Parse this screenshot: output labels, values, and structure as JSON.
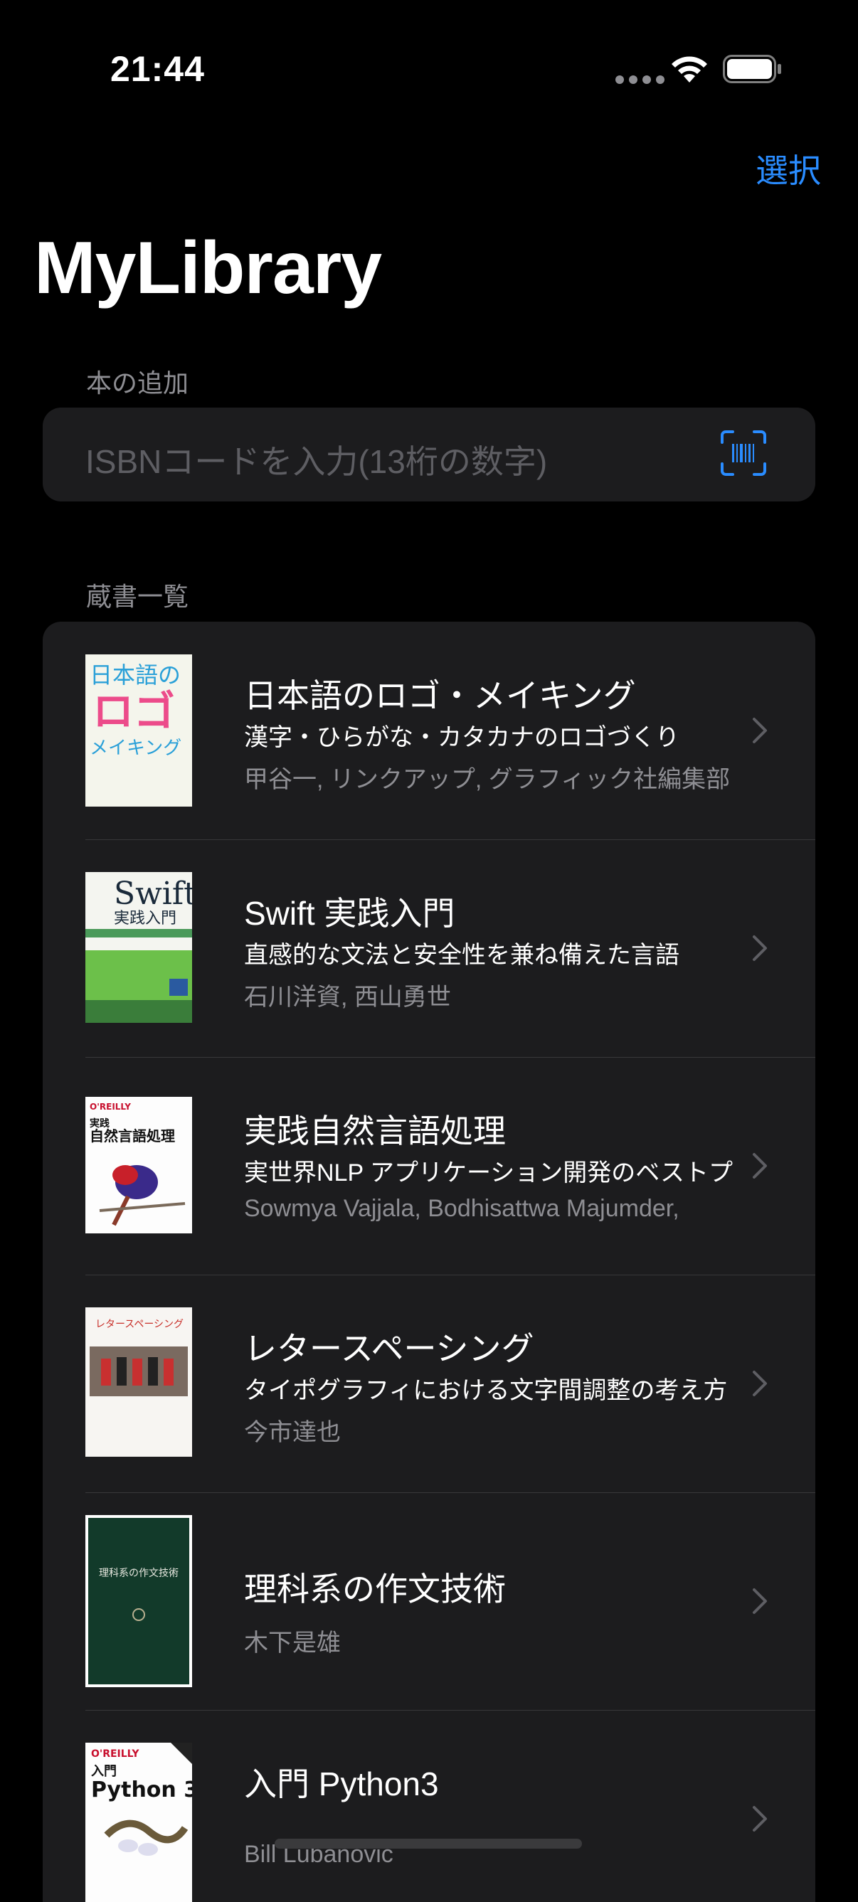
{
  "status_bar": {
    "time": "21:44"
  },
  "nav": {
    "select_label": "選択",
    "title": "MyLibrary"
  },
  "add_section": {
    "header": "本の追加",
    "isbn_placeholder": "ISBNコードを入力(13桁の数字)",
    "scan_icon": "barcode-viewfinder-icon"
  },
  "library_section": {
    "header": "蔵書一覧",
    "books": [
      {
        "title": "日本語のロゴ・メイキング",
        "subtitle": "漢字・ひらがな・カタカナのロゴづくり",
        "authors": "甲谷一, リンクアップ, グラフィック社編集部",
        "cover_text": [
          "日本語の",
          "ロゴ",
          "メイキング"
        ]
      },
      {
        "title": "Swift 実践入門",
        "subtitle": "直感的な文法と安全性を兼ね備えた言語",
        "authors": "石川洋資, 西山勇世",
        "cover_text": [
          "Swift",
          "実践入門"
        ]
      },
      {
        "title": "実践自然言語処理",
        "subtitle": "実世界NLP アプリケーション開発のベストプ",
        "authors": "Sowmya Vajjala, Bodhisattwa Majumder,",
        "cover_text": [
          "O'REILLY",
          "実践",
          "自然言語処理"
        ]
      },
      {
        "title": "レタースペーシング",
        "subtitle": "タイポグラフィにおける文字間調整の考え方",
        "authors": "今市達也",
        "cover_text": [
          "レタースペーシング"
        ]
      },
      {
        "title": "理科系の作文技術",
        "subtitle": "",
        "authors": "木下是雄",
        "cover_text": [
          "理科系の作文技術"
        ]
      },
      {
        "title": "入門 Python3",
        "subtitle": "",
        "authors": "Bill Lubanovic",
        "cover_text": [
          "O'REILLY",
          "入門",
          "Python 3"
        ]
      }
    ]
  },
  "colors": {
    "accent": "#2a8cff",
    "background": "#000000",
    "cell": "#1c1c1e",
    "secondary_text": "#8e8e93"
  }
}
